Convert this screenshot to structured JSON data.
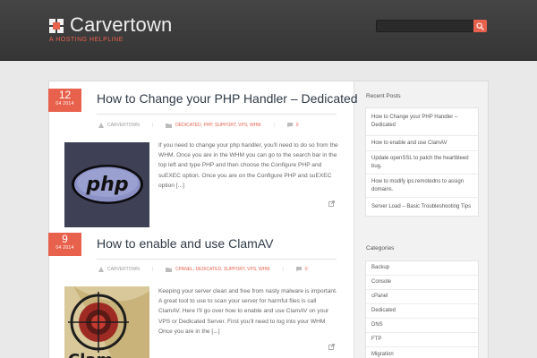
{
  "header": {
    "site_title": "Carvertown",
    "tagline": "A HOSTING HELPLINE"
  },
  "colors": {
    "accent": "#e8614d",
    "header_bg": "#3c3c3c",
    "title": "#2f3a47"
  },
  "posts": [
    {
      "day": "12",
      "month": "04 2014",
      "title": "How to Change your PHP Handler – Dedicated",
      "author": "CARVERTOWN",
      "categories": "DEDICATED, PHP, SUPPORT, VPS, WHM",
      "comments": "0",
      "thumbnail": "php-logo-image",
      "excerpt": "If you need to change your php handler, you'll need to do so from the WHM. Once you are in the WHM you can go to the search bar in the top left and type PHP and then choose the Configure PHP and suEXEC option. Once you are on the Configure PHP and suEXEC option [...]"
    },
    {
      "day": "9",
      "month": "04 2014",
      "title": "How to enable and use ClamAV",
      "author": "CARVERTOWN",
      "categories": "CPANEL, DEDICATED, SUPPORT, VPS, WHM",
      "comments": "0",
      "thumbnail": "clamav-logo-image",
      "excerpt": "Keeping your server clean and free from nasty malware is important.  A great tool to use to scan your server for harmful files is call ClamAV.  Here I'll go over how to enable and use ClamAV on your VPS or Dedicated Server. First you'll need to log into your WHM Once you are in the [...]"
    }
  ],
  "sidebar": {
    "recent_title": "Recent Posts",
    "recent_posts": [
      "How to Change your PHP Handler – Dedicated",
      "How to enable and use ClamAV",
      "Update openSSL to patch the heartbleed bug.",
      "How to modify ips.remotedns to assign domains.",
      "Server Load – Basic Troubleshooting Tips"
    ],
    "categories_title": "Categories",
    "categories": [
      "Backup",
      "Console",
      "cPanel",
      "Dedicated",
      "DNS",
      "FTP",
      "Migration"
    ]
  }
}
